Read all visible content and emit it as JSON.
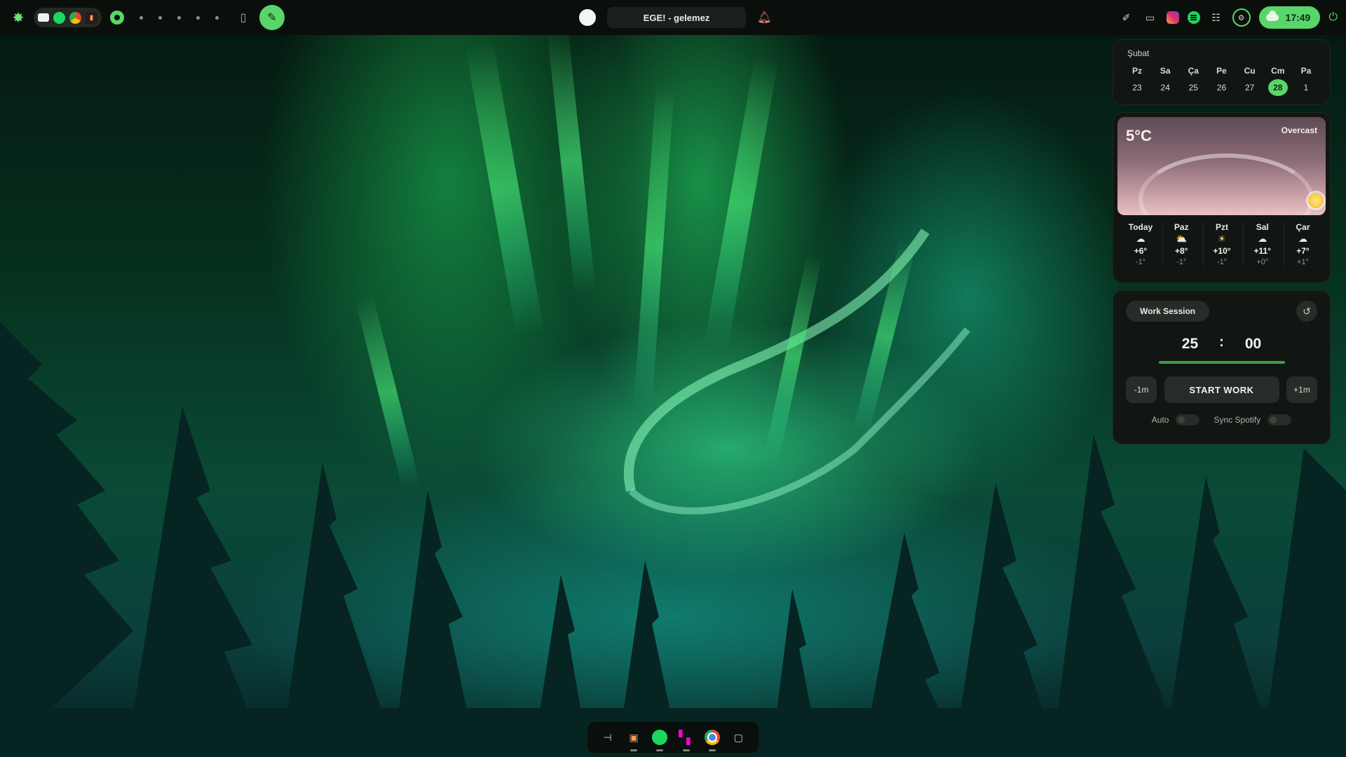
{
  "topbar": {
    "media_title": "EGE! - gelemez",
    "clock": "17:49",
    "workspaces": [
      "1",
      "2",
      "3",
      "4",
      "5",
      "6"
    ]
  },
  "calendar": {
    "month": "Şubat",
    "weekdays": [
      "Pz",
      "Sa",
      "Ça",
      "Pe",
      "Cu",
      "Cm",
      "Pa"
    ],
    "days": [
      "23",
      "24",
      "25",
      "26",
      "27",
      "28",
      "1"
    ],
    "today_index": 5
  },
  "weather": {
    "temp": "5°C",
    "condition": "Overcast",
    "forecast": [
      {
        "name": "Today",
        "icon": "cloud-icon",
        "glyph": "☁",
        "hi": "+6°",
        "lo": "-1°"
      },
      {
        "name": "Paz",
        "icon": "partly-cloudy-icon",
        "glyph": "⛅",
        "hi": "+8°",
        "lo": "-1°"
      },
      {
        "name": "Pzt",
        "icon": "sun-icon",
        "glyph": "☀",
        "hi": "+10°",
        "lo": "-1°"
      },
      {
        "name": "Sal",
        "icon": "cloud-icon",
        "glyph": "☁",
        "hi": "+11°",
        "lo": "+0°"
      },
      {
        "name": "Çar",
        "icon": "cloud-icon",
        "glyph": "☁",
        "hi": "+7°",
        "lo": "+1°"
      }
    ]
  },
  "pomodoro": {
    "session_label": "Work Session",
    "minutes": "25",
    "seconds": "00",
    "progress": 1.0,
    "minus_label": "-1m",
    "start_label": "START WORK",
    "plus_label": "+1m",
    "auto_label": "Auto",
    "sync_label": "Sync Spotify"
  },
  "colors": {
    "accent": "#58d66a",
    "panel": "#121613",
    "bar": "#0b0f0c"
  }
}
